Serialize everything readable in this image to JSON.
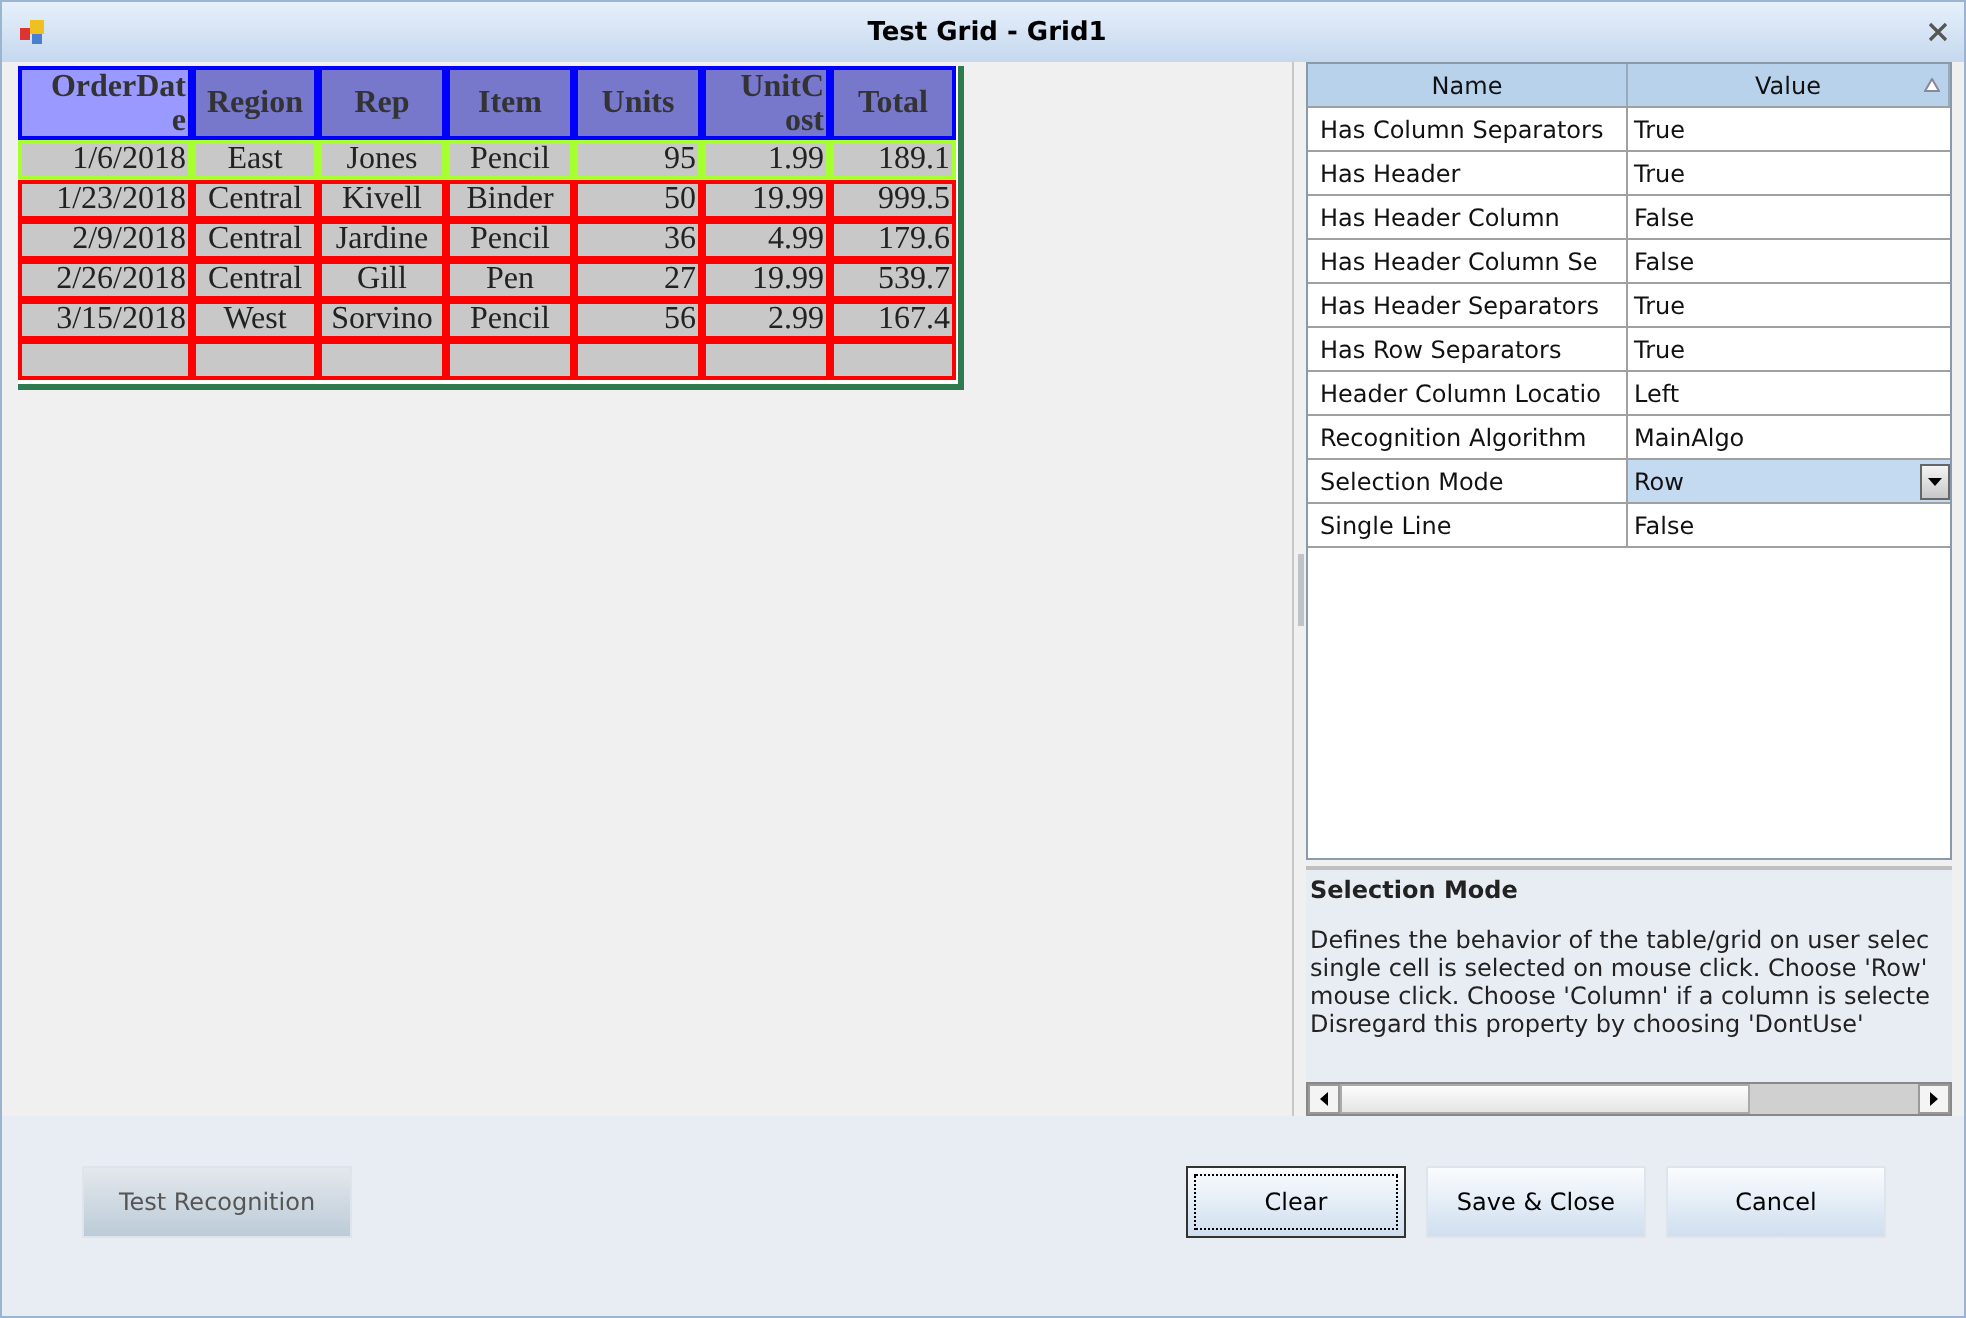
{
  "window": {
    "title": "Test Grid - Grid1"
  },
  "grid": {
    "columns": [
      {
        "label_lines": [
          "OrderDat",
          "e"
        ],
        "selected": true
      },
      {
        "label_lines": [
          "Region"
        ],
        "selected": false
      },
      {
        "label_lines": [
          "Rep"
        ],
        "selected": false
      },
      {
        "label_lines": [
          "Item"
        ],
        "selected": false
      },
      {
        "label_lines": [
          "Units"
        ],
        "selected": false
      },
      {
        "label_lines": [
          "UnitC",
          "ost"
        ],
        "selected": false
      },
      {
        "label_lines": [
          "Total"
        ],
        "selected": false
      }
    ],
    "rows": [
      {
        "selected": true,
        "cells": [
          "1/6/2018",
          "East",
          "Jones",
          "Pencil",
          "95",
          "1.99",
          "189.1"
        ]
      },
      {
        "selected": false,
        "cells": [
          "1/23/2018",
          "Central",
          "Kivell",
          "Binder",
          "50",
          "19.99",
          "999.5"
        ]
      },
      {
        "selected": false,
        "cells": [
          "2/9/2018",
          "Central",
          "Jardine",
          "Pencil",
          "36",
          "4.99",
          "179.6"
        ]
      },
      {
        "selected": false,
        "cells": [
          "2/26/2018",
          "Central",
          "Gill",
          "Pen",
          "27",
          "19.99",
          "539.7"
        ]
      },
      {
        "selected": false,
        "cells": [
          "3/15/2018",
          "West",
          "Sorvino",
          "Pencil",
          "56",
          "2.99",
          "167.4"
        ]
      },
      {
        "selected": false,
        "cells": [
          "",
          "",
          "",
          "",
          "",
          "",
          ""
        ]
      }
    ]
  },
  "properties": {
    "columns": [
      "Name",
      "Value"
    ],
    "rows": [
      {
        "name": "Has Column Separators",
        "value": "True",
        "selected": false
      },
      {
        "name": "Has Header",
        "value": "True",
        "selected": false
      },
      {
        "name": "Has Header Column",
        "value": "False",
        "selected": false
      },
      {
        "name": "Has Header Column Se",
        "value": "False",
        "selected": false
      },
      {
        "name": "Has Header Separators",
        "value": "True",
        "selected": false
      },
      {
        "name": "Has Row Separators",
        "value": "True",
        "selected": false
      },
      {
        "name": "Header Column Locatio",
        "value": "Left",
        "selected": false
      },
      {
        "name": "Recognition Algorithm",
        "value": "MainAlgo",
        "selected": false
      },
      {
        "name": "Selection Mode",
        "value": "Row",
        "selected": true
      },
      {
        "name": "Single Line",
        "value": "False",
        "selected": false
      }
    ]
  },
  "description": {
    "title": "Selection Mode",
    "text": "Defines the behavior of the table/grid on user selec\nsingle cell is selected on mouse click. Choose 'Row'\nmouse click. Choose 'Column' if a column is selecte\nDisregard this property by choosing 'DontUse'"
  },
  "buttons": [
    {
      "label": "Test Recognition",
      "disabled": true,
      "focused": false
    },
    {
      "label": "Clear",
      "disabled": false,
      "focused": true
    },
    {
      "label": "Save & Close",
      "disabled": false,
      "focused": false
    },
    {
      "label": "Cancel",
      "disabled": false,
      "focused": false
    }
  ]
}
